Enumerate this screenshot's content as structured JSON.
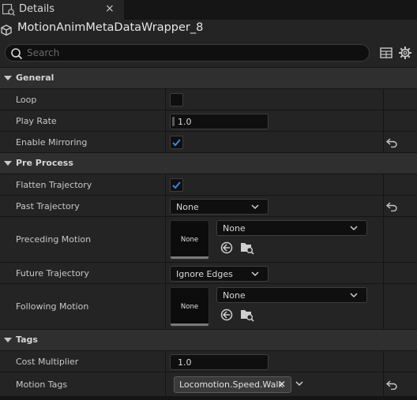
{
  "tab": {
    "title": "Details",
    "close": "×",
    "icon": "details-icon"
  },
  "object": {
    "title": "MotionAnimMetaDataWrapper_8",
    "icon": "object-icon"
  },
  "search": {
    "placeholder": "Search"
  },
  "sections": {
    "general": {
      "label": "General"
    },
    "pre_process": {
      "label": "Pre Process"
    },
    "tags": {
      "label": "Tags"
    }
  },
  "properties": {
    "loop": {
      "label": "Loop",
      "checked": false
    },
    "play_rate": {
      "label": "Play Rate",
      "value": "1.0"
    },
    "enable_mirroring": {
      "label": "Enable Mirroring",
      "checked": true
    },
    "flatten_trajectory": {
      "label": "Flatten Trajectory",
      "checked": true
    },
    "past_trajectory": {
      "label": "Past Trajectory",
      "value": "None"
    },
    "preceding_motion": {
      "label": "Preceding Motion",
      "thumb": "None",
      "value": "None"
    },
    "future_trajectory": {
      "label": "Future Trajectory",
      "value": "Ignore Edges"
    },
    "following_motion": {
      "label": "Following Motion",
      "thumb": "None",
      "value": "None"
    },
    "cost_multiplier": {
      "label": "Cost Multiplier",
      "value": "1.0"
    },
    "motion_tags": {
      "label": "Motion Tags",
      "tag": "Locomotion.Speed.Walk",
      "remove": "✕"
    }
  },
  "colors": {
    "accent_check": "#3b84e0",
    "panel": "#242424",
    "section": "#2f2f2f"
  }
}
